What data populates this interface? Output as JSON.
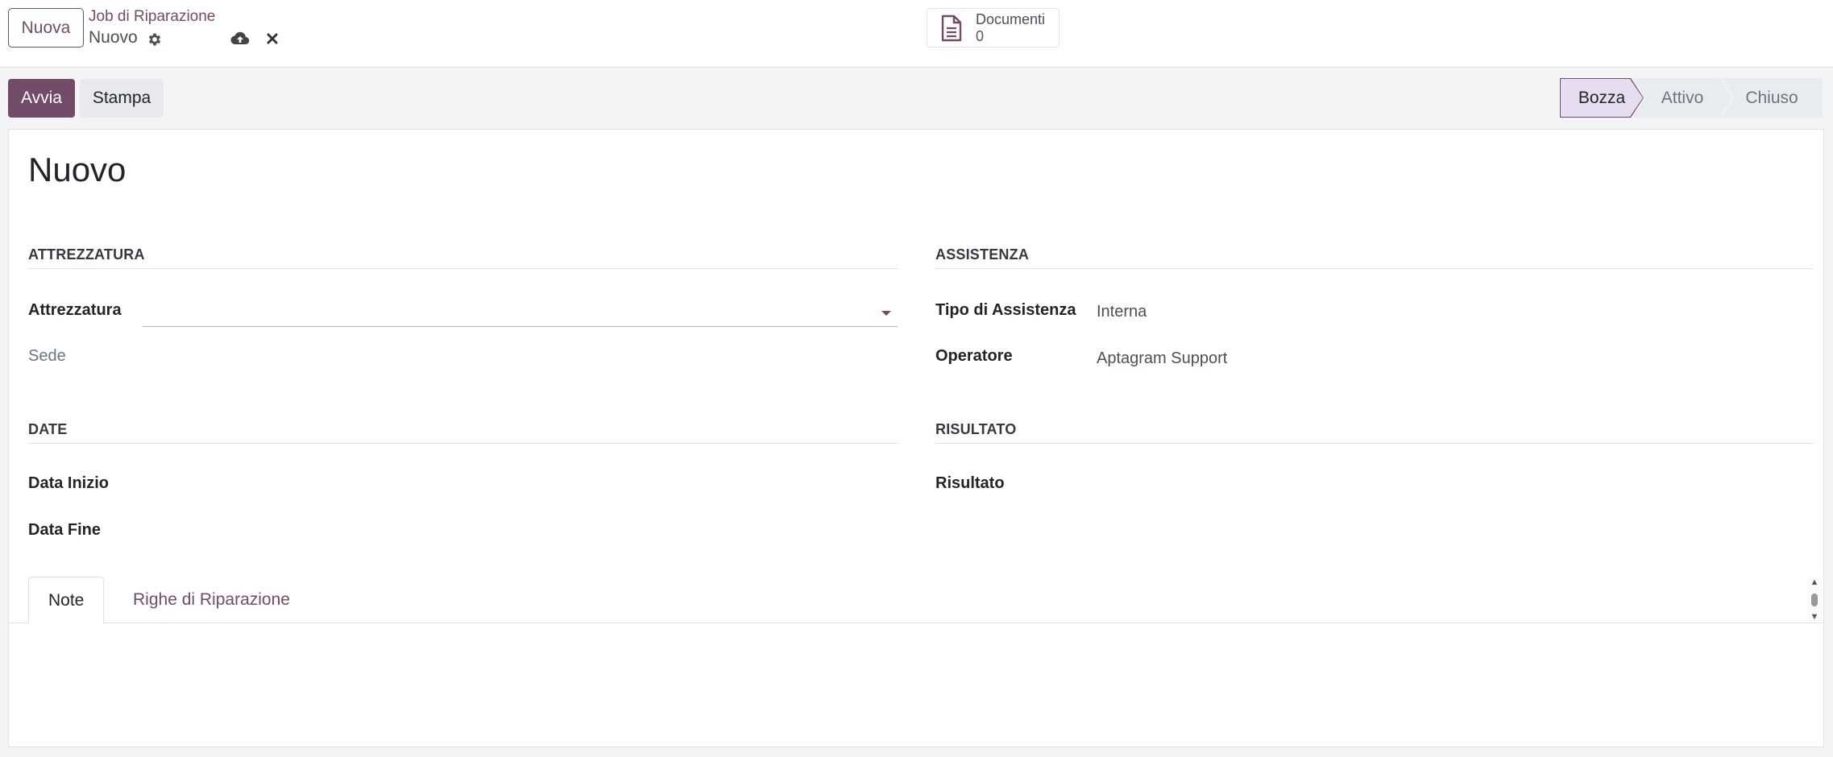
{
  "control_panel": {
    "new_button": "Nuova",
    "breadcrumb_parent": "Job di Riparazione",
    "breadcrumb_current": "Nuovo"
  },
  "smart_button": {
    "label": "Documenti",
    "count": "0"
  },
  "actions": {
    "primary": "Avvia",
    "secondary": "Stampa"
  },
  "stages": [
    {
      "label": "Bozza",
      "active": true
    },
    {
      "label": "Attivo",
      "active": false
    },
    {
      "label": "Chiuso",
      "active": false
    }
  ],
  "form": {
    "title": "Nuovo",
    "groups": {
      "equipment": {
        "title": "ATTREZZATURA",
        "equipment_label": "Attrezzatura",
        "equipment_value": "",
        "site_label": "Sede"
      },
      "assistance": {
        "title": "ASSISTENZA",
        "type_label": "Tipo di Assistenza",
        "type_value": "Interna",
        "operator_label": "Operatore",
        "operator_value": "Aptagram Support"
      },
      "dates": {
        "title": "DATE",
        "start_label": "Data Inizio",
        "end_label": "Data Fine"
      },
      "result": {
        "title": "RISULTATO",
        "result_label": "Risultato"
      }
    },
    "tabs": [
      {
        "label": "Note",
        "active": true
      },
      {
        "label": "Righe di Riparazione",
        "active": false
      }
    ]
  },
  "colors": {
    "brand": "#714b67",
    "stage_active_bg": "#e6ddf0"
  }
}
